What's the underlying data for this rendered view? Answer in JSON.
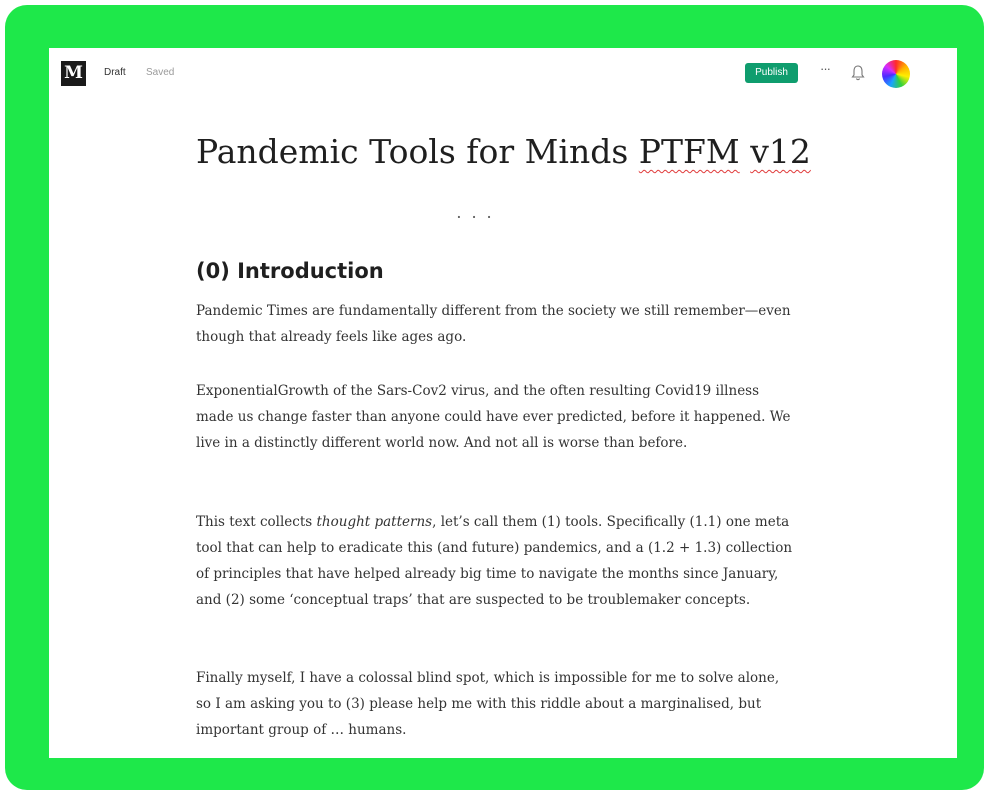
{
  "topbar": {
    "logo": "M",
    "status_draft": "Draft",
    "status_saved": "Saved",
    "publish_label": "Publish",
    "more_label": "···",
    "icons": [
      "more-icon",
      "bell-icon",
      "avatar"
    ]
  },
  "article": {
    "title_main": "Pandemic Tools for Minds ",
    "title_acronym": "PTFM",
    "title_version": "v12",
    "separator": "...",
    "heading": "(0) Introduction",
    "paragraphs": {
      "p1": "Pandemic Times are fundamentally different from the society we still remember—even though that already feels like ages ago.",
      "p2": "ExponentialGrowth of the Sars-Cov2 virus, and the often resulting Covid19 illness made us change faster than anyone could have ever predicted, before it happened. We live in a distinctly different world now. And not all is worse than before.",
      "p3_before": "This text collects ",
      "p3_italic": "thought patterns",
      "p3_after": ", let’s call them (1) tools. Specifically (1.1) one meta tool that can help to eradicate this (and future) pandemics, and a (1.2 + 1.3) collection of principles that have helped already big time to navigate the months since January, and (2) some ‘conceptual traps’ that are suspected to be troublemaker concepts.",
      "p4": "Finally myself, I have a colossal blind spot, which is impossible for me to solve alone, so I am asking you to (3) please help me with this riddle about a marginalised, but important group of … humans."
    }
  },
  "colors": {
    "frame": "#1ee84a",
    "publish": "#0f9d6e",
    "spellcheck": "#e03a3a"
  }
}
